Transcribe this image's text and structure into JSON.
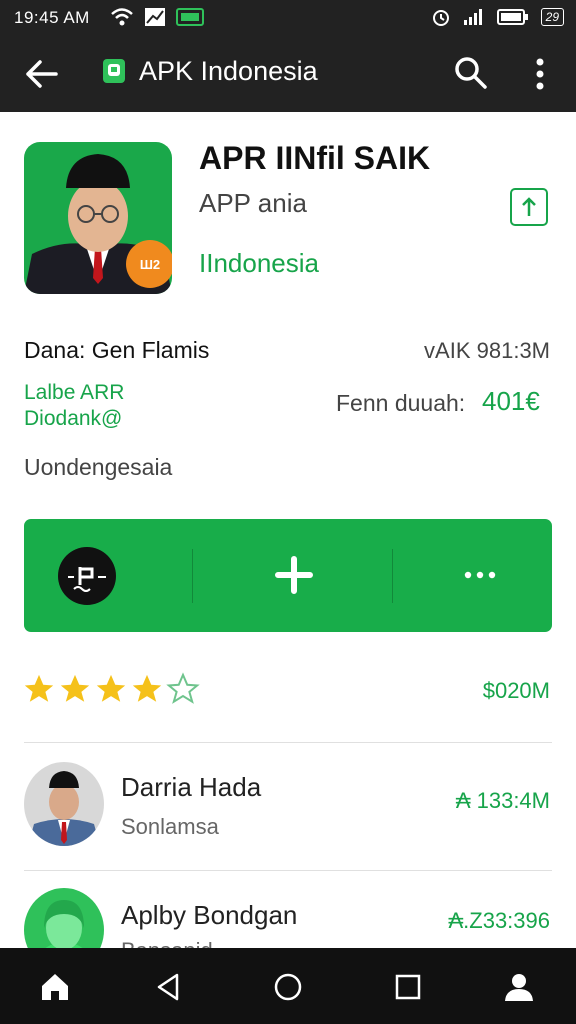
{
  "status_bar": {
    "time": "19:45 AM",
    "battery": "29"
  },
  "app_bar": {
    "title": "APK Indonesia"
  },
  "app": {
    "name": "APR IINfil SAIK",
    "subtitle": "APP ania",
    "country": "IIndonesia",
    "icon_badge": "Ш2"
  },
  "meta": {
    "date": "Dana: Gen Flamis",
    "version": "vAIK 981:3M",
    "green_line1": "Lalbe ARR",
    "green_line2": "Diodank@",
    "size_label": "Fenn duuah:",
    "size_value": "401€",
    "language": "Uondengesaia"
  },
  "rating": {
    "stars": 4,
    "max": 5,
    "downloads": "$020M"
  },
  "list": [
    {
      "name": "Darria Hada",
      "sub": "Sonlamsa",
      "meta": "₳ 133:4M"
    },
    {
      "name": "Aplby Bondgan",
      "sub": "Bansanid",
      "meta": "₳.Z33:396"
    }
  ],
  "colors": {
    "accent": "#18ad4a",
    "bars": "#222222"
  }
}
